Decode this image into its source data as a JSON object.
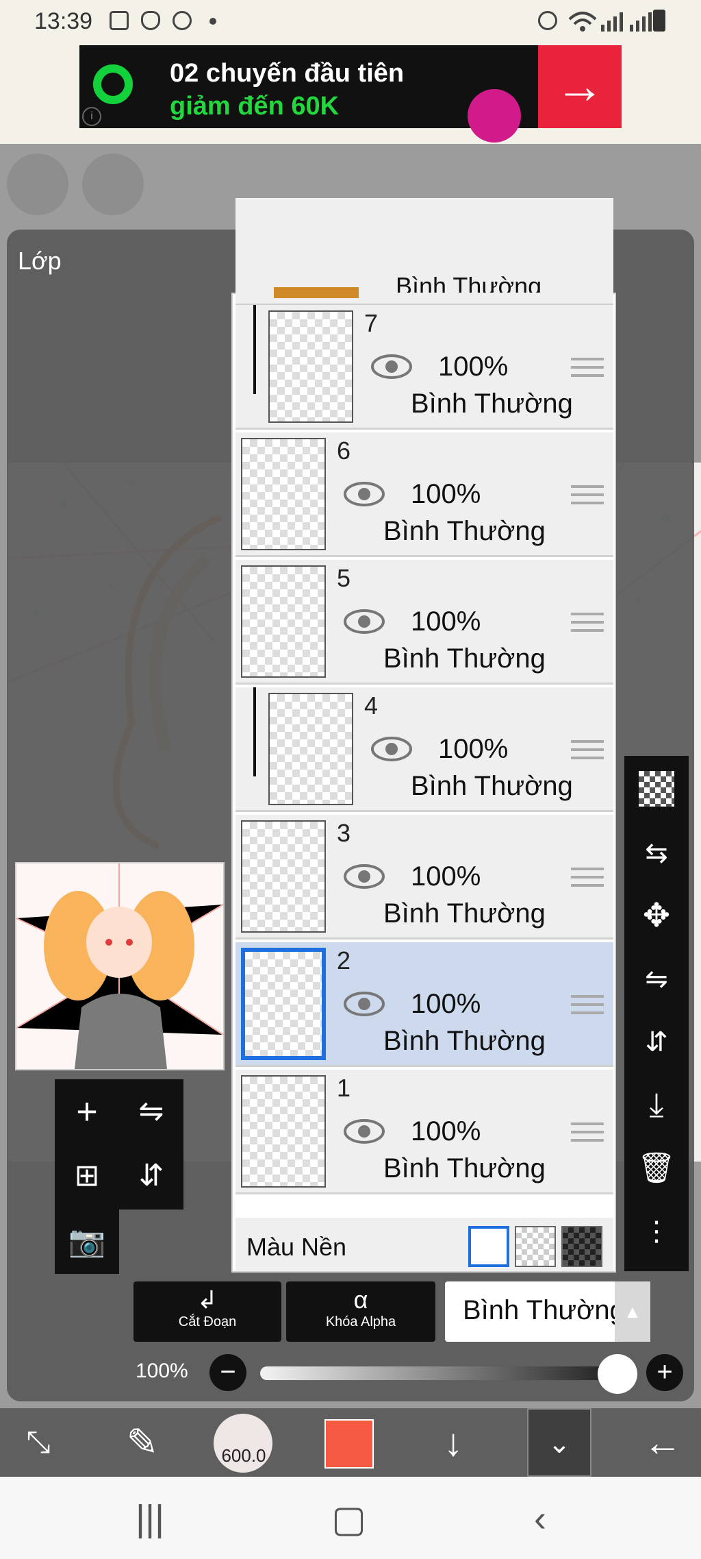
{
  "status_bar": {
    "time": "13:39"
  },
  "ad": {
    "line1": "02 chuyến đầu tiên",
    "line2": "giảm đến 60K",
    "info": "i",
    "arrow": "→"
  },
  "panel": {
    "title": "Lớp"
  },
  "layers": [
    {
      "number": "7",
      "opacity": "100%",
      "mode": "Bình Thường",
      "clipped": true,
      "selected": false
    },
    {
      "number": "6",
      "opacity": "100%",
      "mode": "Bình Thường",
      "clipped": false,
      "selected": false
    },
    {
      "number": "5",
      "opacity": "100%",
      "mode": "Bình Thường",
      "clipped": false,
      "selected": false
    },
    {
      "number": "4",
      "opacity": "100%",
      "mode": "Bình Thường",
      "clipped": true,
      "selected": false
    },
    {
      "number": "3",
      "opacity": "100%",
      "mode": "Bình Thường",
      "clipped": false,
      "selected": false
    },
    {
      "number": "2",
      "opacity": "100%",
      "mode": "Bình Thường",
      "clipped": false,
      "selected": true
    },
    {
      "number": "1",
      "opacity": "100%",
      "mode": "Bình Thường",
      "clipped": false,
      "selected": false
    }
  ],
  "top_partial_layer": {
    "mode": "Bình Thường"
  },
  "background": {
    "label": "Màu Nền"
  },
  "bottom": {
    "clipping_label": "Cắt Đoạn",
    "alpha_lock_label": "Khóa Alpha",
    "blend_mode": "Bình Thường",
    "opacity_label": "100%",
    "opacity_value": 1.0
  },
  "toolbar": {
    "brush_size": "600.0",
    "color": "#f75a43"
  },
  "colors": {
    "accent": "#1e6fe0",
    "selected_layer": "#cddaee"
  }
}
